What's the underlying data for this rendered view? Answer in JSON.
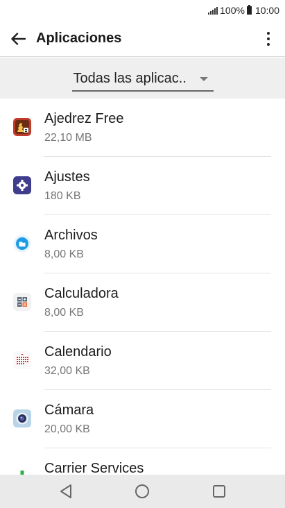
{
  "status": {
    "battery": "100%",
    "time": "10:00"
  },
  "appbar": {
    "title": "Aplicaciones"
  },
  "filter": {
    "selected": "Todas las aplicac.."
  },
  "apps": [
    {
      "name": "Ajedrez Free",
      "size": "22,10 MB",
      "icon": "chess-icon"
    },
    {
      "name": "Ajustes",
      "size": "180 KB",
      "icon": "settings-gear-icon"
    },
    {
      "name": "Archivos",
      "size": "8,00 KB",
      "icon": "folder-icon"
    },
    {
      "name": "Calculadora",
      "size": "8,00 KB",
      "icon": "calculator-icon"
    },
    {
      "name": "Calendario",
      "size": "32,00 KB",
      "icon": "calendar-icon"
    },
    {
      "name": "Cámara",
      "size": "20,00 KB",
      "icon": "camera-icon"
    },
    {
      "name": "Carrier Services",
      "size": "",
      "icon": "carrier-services-icon"
    }
  ],
  "colors": {
    "filter_bg": "#efefef",
    "navbar_bg": "#eaeaea",
    "divider": "#e3e3e3"
  }
}
